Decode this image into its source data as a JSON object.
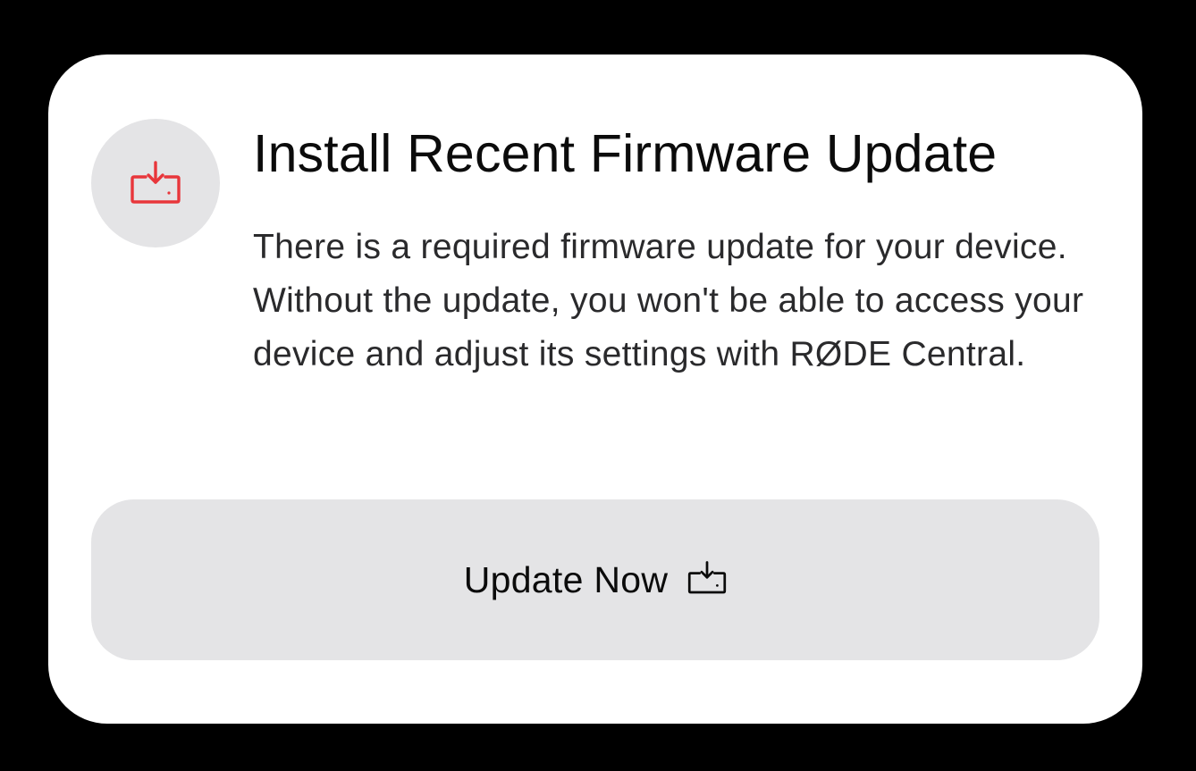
{
  "dialog": {
    "title": "Install Recent Firmware Update",
    "description": "There is a required firmware update for your device. Without the update, you won't be able to access your device and adjust its settings with RØDE Central.",
    "icon": "download-tray-icon",
    "icon_color": "#e8363b"
  },
  "actions": {
    "update_label": "Update Now",
    "update_icon": "download-tray-icon"
  },
  "colors": {
    "background": "#000000",
    "card": "#ffffff",
    "button": "#e4e4e6",
    "accent": "#e8363b"
  }
}
